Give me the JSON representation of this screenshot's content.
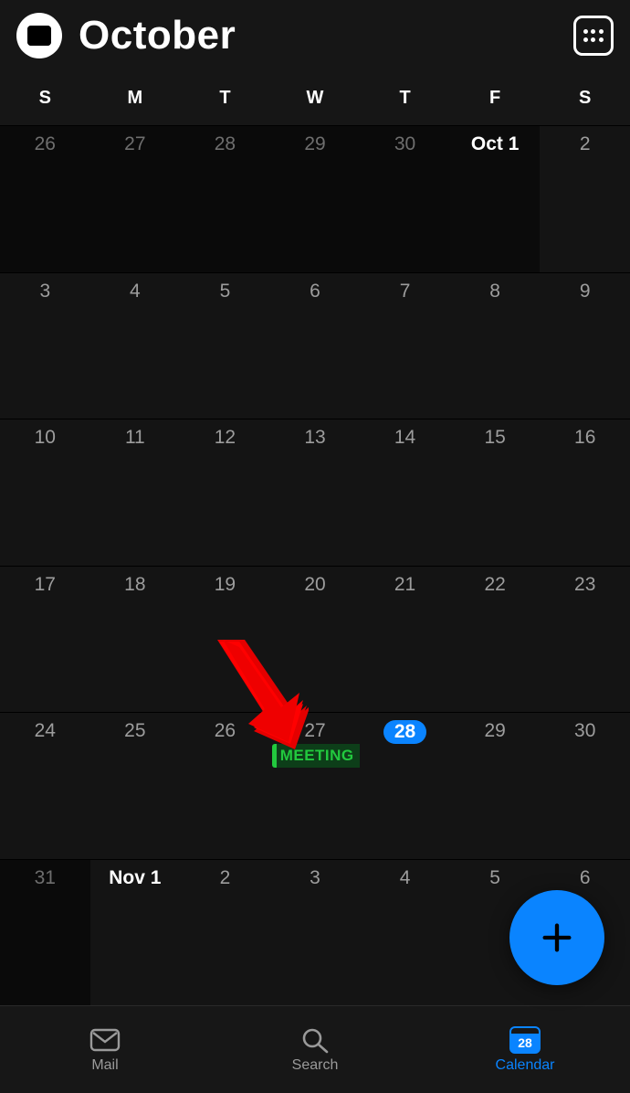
{
  "header": {
    "month": "October"
  },
  "weekdays": [
    "S",
    "M",
    "T",
    "W",
    "T",
    "F",
    "S"
  ],
  "grid": {
    "rows": [
      [
        {
          "label": "26",
          "out": true
        },
        {
          "label": "27",
          "out": true
        },
        {
          "label": "28",
          "out": true
        },
        {
          "label": "29",
          "out": true
        },
        {
          "label": "30",
          "out": true
        },
        {
          "label": "Oct 1",
          "strong": true,
          "todaybg": true
        },
        {
          "label": "2"
        }
      ],
      [
        {
          "label": "3"
        },
        {
          "label": "4"
        },
        {
          "label": "5"
        },
        {
          "label": "6"
        },
        {
          "label": "7"
        },
        {
          "label": "8"
        },
        {
          "label": "9"
        }
      ],
      [
        {
          "label": "10"
        },
        {
          "label": "11"
        },
        {
          "label": "12"
        },
        {
          "label": "13"
        },
        {
          "label": "14"
        },
        {
          "label": "15"
        },
        {
          "label": "16"
        }
      ],
      [
        {
          "label": "17"
        },
        {
          "label": "18"
        },
        {
          "label": "19"
        },
        {
          "label": "20"
        },
        {
          "label": "21"
        },
        {
          "label": "22"
        },
        {
          "label": "23"
        }
      ],
      [
        {
          "label": "24"
        },
        {
          "label": "25"
        },
        {
          "label": "26"
        },
        {
          "label": "27",
          "event": "MEETING"
        },
        {
          "label": "28",
          "today": true
        },
        {
          "label": "29"
        },
        {
          "label": "30"
        }
      ],
      [
        {
          "label": "31",
          "out": true
        },
        {
          "label": "Nov 1",
          "strong": true
        },
        {
          "label": "2"
        },
        {
          "label": "3"
        },
        {
          "label": "4"
        },
        {
          "label": "5"
        },
        {
          "label": "6"
        }
      ]
    ]
  },
  "fab": {
    "label": "+"
  },
  "tabs": {
    "mail": "Mail",
    "search": "Search",
    "calendar": "Calendar",
    "calendar_day": "28"
  }
}
